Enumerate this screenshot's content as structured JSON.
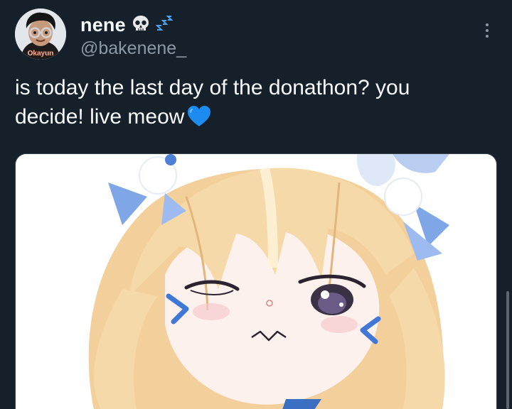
{
  "tweet": {
    "author": {
      "display_name": "nene",
      "name_icons": [
        "skull-icon",
        "zzz-icon"
      ],
      "handle": "@bakenene_",
      "avatar_badge": "Okayun"
    },
    "text": "is today the last day of the donathon? you decide! live meow",
    "emoji": "blue-heart-icon",
    "more_icon": "more-options-icon"
  },
  "colors": {
    "background": "#15202b",
    "text": "#f7f9f9",
    "secondary_text": "#8b98a5",
    "heart": "#1d8cf0",
    "hair": "#f6d9a8",
    "ribbon": "#7fa6e6"
  }
}
